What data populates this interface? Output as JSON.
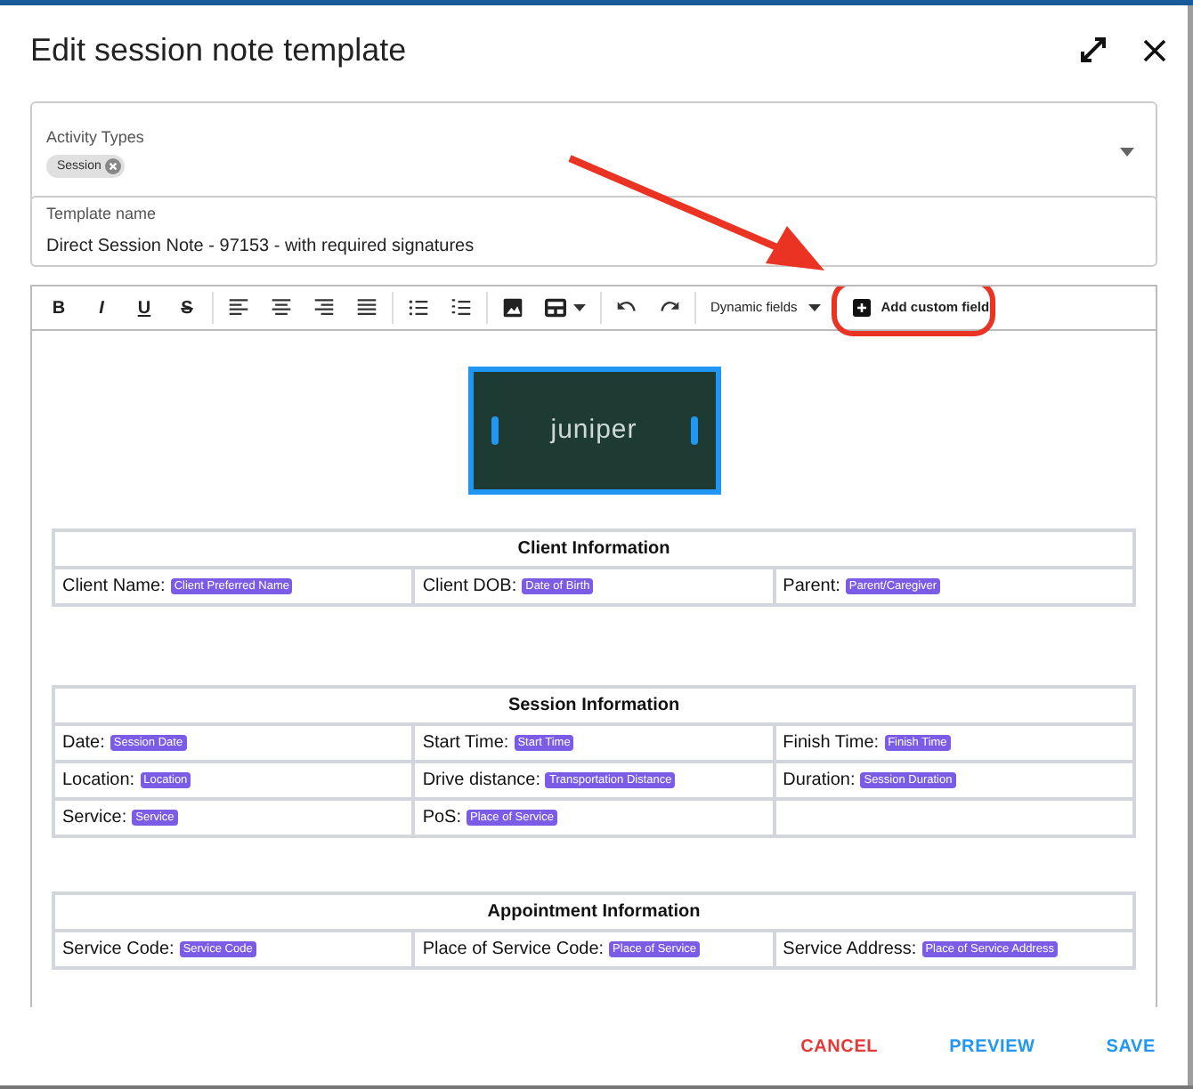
{
  "dialog": {
    "title": "Edit session note template"
  },
  "activity_types": {
    "label": "Activity Types",
    "chips": [
      "Session"
    ]
  },
  "template_name": {
    "label": "Template name",
    "value": "Direct Session Note - 97153 - with required signatures"
  },
  "toolbar": [
    {
      "kind": "bold",
      "label": "B"
    },
    {
      "kind": "italic",
      "label": "I"
    },
    {
      "kind": "underline",
      "label": "U"
    },
    {
      "kind": "strikethrough",
      "label": "S"
    },
    {
      "kind": "separator"
    },
    {
      "kind": "alignleft"
    },
    {
      "kind": "aligncenter"
    },
    {
      "kind": "alignright"
    },
    {
      "kind": "justify"
    },
    {
      "kind": "separator"
    },
    {
      "kind": "bullets"
    },
    {
      "kind": "numbering"
    },
    {
      "kind": "separator"
    },
    {
      "kind": "image"
    },
    {
      "kind": "table"
    },
    {
      "kind": "separator"
    },
    {
      "kind": "undo"
    },
    {
      "kind": "redo"
    },
    {
      "kind": "separator"
    },
    {
      "kind": "dropdown",
      "label": "Dynamic fields"
    },
    {
      "kind": "add",
      "label": "Add custom field",
      "highlighted": true
    }
  ],
  "logo": {
    "text": "juniper",
    "selected": true
  },
  "tables": [
    {
      "title": "Client Information",
      "rows": [
        [
          {
            "kind": "field",
            "label": "Client Name:",
            "tag": "Client Preferred Name"
          },
          {
            "kind": "field",
            "label": "Client DOB:",
            "tag": "Date of Birth"
          },
          {
            "kind": "field",
            "label": "Parent:",
            "tag": "Parent/Caregiver"
          }
        ]
      ]
    },
    {
      "title": "Session Information",
      "rows": [
        [
          {
            "kind": "field",
            "label": "Date:",
            "tag": "Session Date"
          },
          {
            "kind": "field",
            "label": "Start Time:",
            "tag": "Start Time"
          },
          {
            "kind": "field",
            "label": "Finish Time:",
            "tag": "Finish Time"
          }
        ],
        [
          {
            "kind": "field",
            "label": "Location:",
            "tag": "Location"
          },
          {
            "kind": "field",
            "label": "Drive distance:",
            "tag": "Transportation Distance"
          },
          {
            "kind": "field",
            "label": "Duration:",
            "tag": "Session Duration"
          }
        ],
        [
          {
            "kind": "field",
            "label": "Service:",
            "tag": "Service"
          },
          {
            "kind": "field",
            "label": "PoS:",
            "tag": "Place of Service"
          },
          {
            "kind": "empty"
          }
        ]
      ]
    },
    {
      "title": "Appointment Information",
      "rows": [
        [
          {
            "kind": "field",
            "label": "Service Code:",
            "tag": "Service Code"
          },
          {
            "kind": "field",
            "label": "Place of Service Code:",
            "tag": "Place of Service"
          },
          {
            "kind": "field",
            "label": "Service Address:",
            "tag": "Place of Service Address"
          }
        ]
      ]
    }
  ],
  "footer_buttons": [
    {
      "label": "CANCEL",
      "kind": "danger"
    },
    {
      "label": "PREVIEW",
      "kind": "primary"
    },
    {
      "label": "SAVE",
      "kind": "primary"
    }
  ]
}
